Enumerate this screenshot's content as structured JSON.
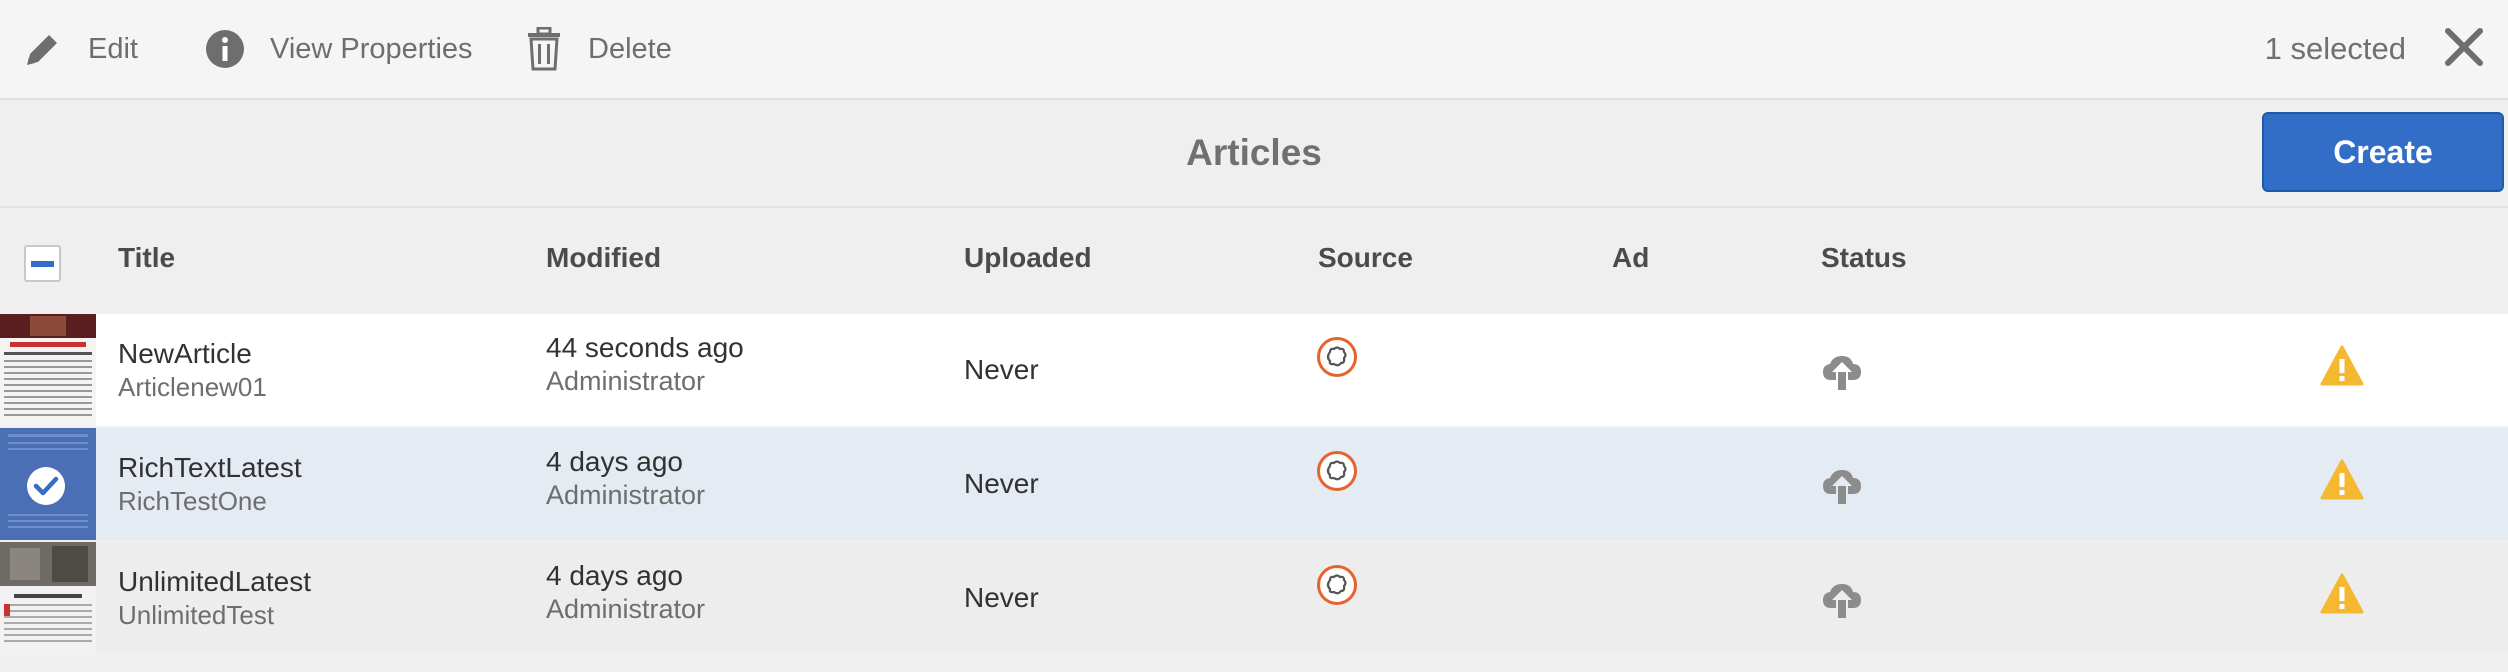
{
  "toolbar": {
    "edit_label": "Edit",
    "view_properties_label": "View Properties",
    "delete_label": "Delete",
    "selected_count": "1 selected"
  },
  "header": {
    "title": "Articles",
    "create_label": "Create"
  },
  "columns": [
    "Title",
    "Modified",
    "Uploaded",
    "Source",
    "Ad",
    "Status"
  ],
  "rows": [
    {
      "title": "NewArticle",
      "name": "Articlenew01",
      "modified": "44 seconds ago",
      "modified_by": "Administrator",
      "uploaded": "Never",
      "source_icon": "source-cloud-icon",
      "status_icon": "upload-cloud-icon",
      "alert_icon": "warning-icon",
      "selected": false
    },
    {
      "title": "RichTextLatest",
      "name": "RichTestOne",
      "modified": "4 days ago",
      "modified_by": "Administrator",
      "uploaded": "Never",
      "source_icon": "source-cloud-icon",
      "status_icon": "upload-cloud-icon",
      "alert_icon": "warning-icon",
      "selected": true
    },
    {
      "title": "UnlimitedLatest",
      "name": "UnlimitedTest",
      "modified": "4 days ago",
      "modified_by": "Administrator",
      "uploaded": "Never",
      "source_icon": "source-cloud-icon",
      "status_icon": "upload-cloud-icon",
      "alert_icon": "warning-icon",
      "selected": false
    }
  ],
  "colors": {
    "accent": "#326ec8",
    "source_ring": "#e8632b",
    "warning": "#f5b831",
    "selected_row": "#e5ebf3"
  }
}
